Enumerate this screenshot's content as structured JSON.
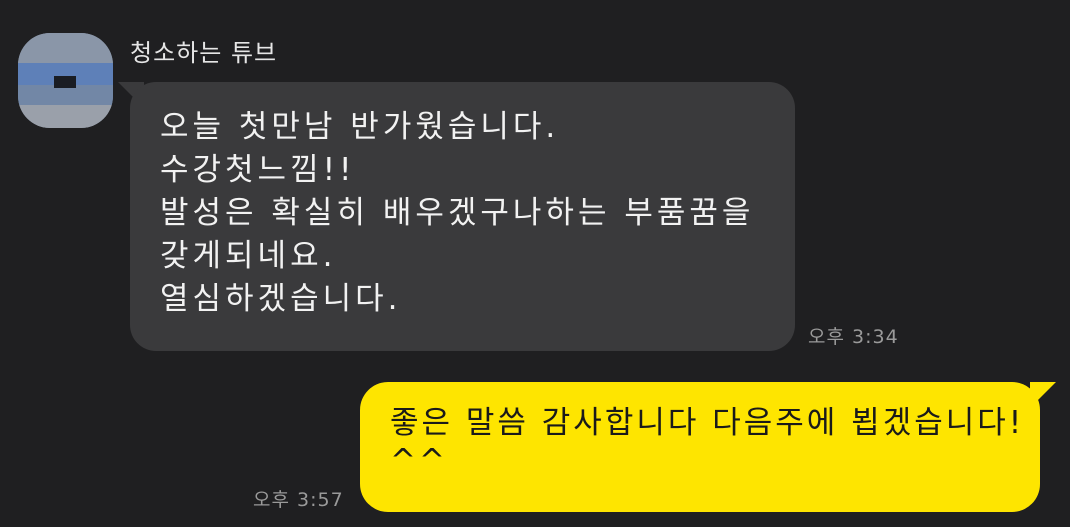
{
  "chat": {
    "sender_name": "청소하는 튜브",
    "incoming_message": {
      "lines": [
        "오늘 첫만남 반가웠습니다.",
        "수강첫느낌!!",
        "발성은 확실히 배우겠구나하는 부품꿈을",
        "갖게되네요.",
        "열심하겠습니다."
      ],
      "time": "오후 3:34"
    },
    "outgoing_message": {
      "lines": [
        "좋은 말씀 감사합니다 다음주에 뵙겠습니다!",
        "^^"
      ],
      "time": "오후 3:57"
    }
  },
  "colors": {
    "background": "#1f1f21",
    "incoming_bubble": "#3a3a3c",
    "outgoing_bubble": "#fee500"
  },
  "icons": {
    "avatar": "blurred-profile-avatar"
  }
}
